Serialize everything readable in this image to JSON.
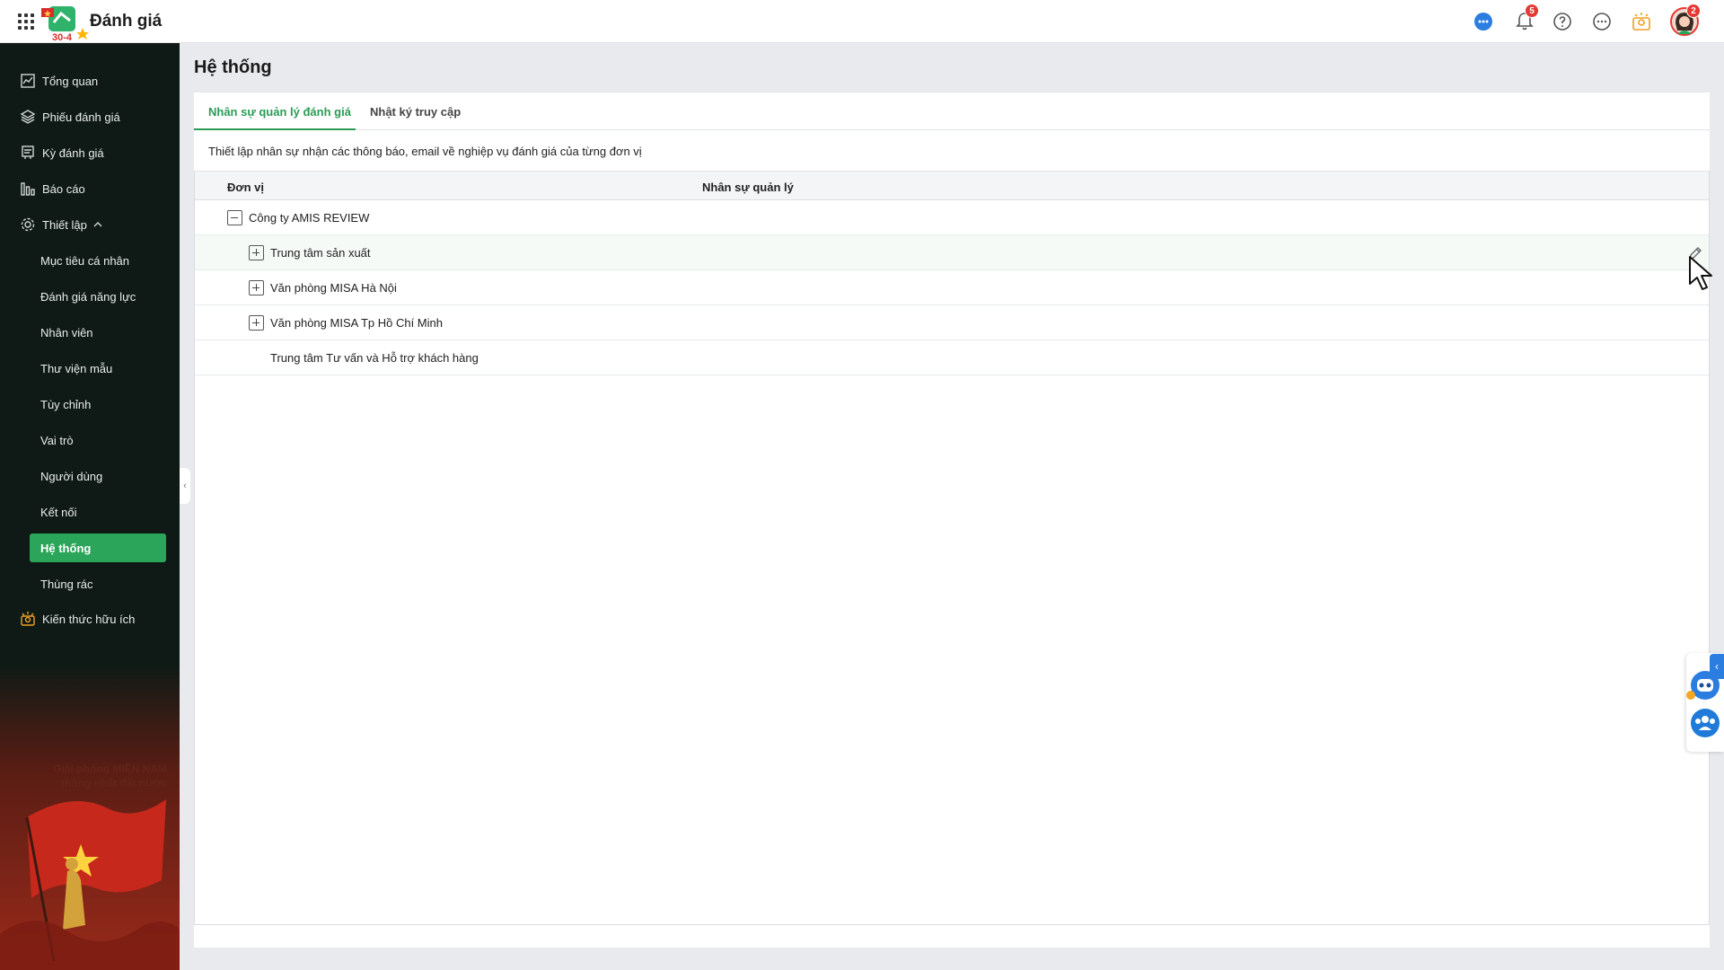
{
  "header": {
    "app_title": "Đánh giá",
    "logo_text": "30-4",
    "notification_count": "5",
    "avatar_count": "2",
    "icons": [
      "apps-grid-icon",
      "chat-icon",
      "bell-icon",
      "help-icon",
      "more-icon",
      "lightbulb-icon",
      "avatar"
    ]
  },
  "sidebar": {
    "items": [
      {
        "label": "Tổng quan",
        "icon": "chart-line-icon"
      },
      {
        "label": "Phiếu đánh giá",
        "icon": "layers-icon"
      },
      {
        "label": "Kỳ đánh giá",
        "icon": "calendar-doc-icon"
      },
      {
        "label": "Báo cáo",
        "icon": "bar-chart-icon"
      },
      {
        "label": "Thiết lập",
        "icon": "gear-icon"
      }
    ],
    "sub_items": [
      {
        "label": "Mục tiêu cá nhân"
      },
      {
        "label": "Đánh giá năng lực"
      },
      {
        "label": "Nhân viên"
      },
      {
        "label": "Thư viện mẫu"
      },
      {
        "label": "Tùy chỉnh"
      },
      {
        "label": "Vai trò"
      },
      {
        "label": "Người dùng"
      },
      {
        "label": "Kết nối"
      },
      {
        "label": "Hệ thống",
        "active": true
      },
      {
        "label": "Thùng rác"
      }
    ],
    "bottom_item": {
      "label": "Kiến thức hữu ích",
      "icon": "lightbulb-icon"
    },
    "banner_text": "Giải phóng MIỀN NAM thống nhất đất nước"
  },
  "main": {
    "title": "Hệ thống",
    "tabs": [
      {
        "label": "Nhân sự quản lý đánh giá",
        "active": true
      },
      {
        "label": "Nhật ký truy cập",
        "active": false
      }
    ],
    "description": "Thiết lập nhân sự nhận các thông báo, email về nghiệp vụ đánh giá của từng đơn vị",
    "table": {
      "columns": [
        "Đơn vị",
        "Nhân sự quản lý"
      ],
      "rows": [
        {
          "name": "Công ty AMIS REVIEW",
          "level": 0,
          "toggle": "collapse"
        },
        {
          "name": "Trung tâm sản xuất",
          "level": 1,
          "toggle": "expand"
        },
        {
          "name": "Văn phòng MISA Hà Nội",
          "level": 1,
          "toggle": "expand"
        },
        {
          "name": "Văn phòng MISA Tp Hồ Chí Minh",
          "level": 1,
          "toggle": "expand"
        },
        {
          "name": "Trung tâm Tư vấn và Hỗ trợ khách hàng",
          "level": 1,
          "toggle": "none"
        }
      ]
    }
  },
  "colors": {
    "sidebar_bg": "#0f1a16",
    "accent_green": "#2aa55a",
    "tab_active": "#2a9b55",
    "badge_red": "#e53935",
    "brand_blue": "#2b7ee0"
  }
}
